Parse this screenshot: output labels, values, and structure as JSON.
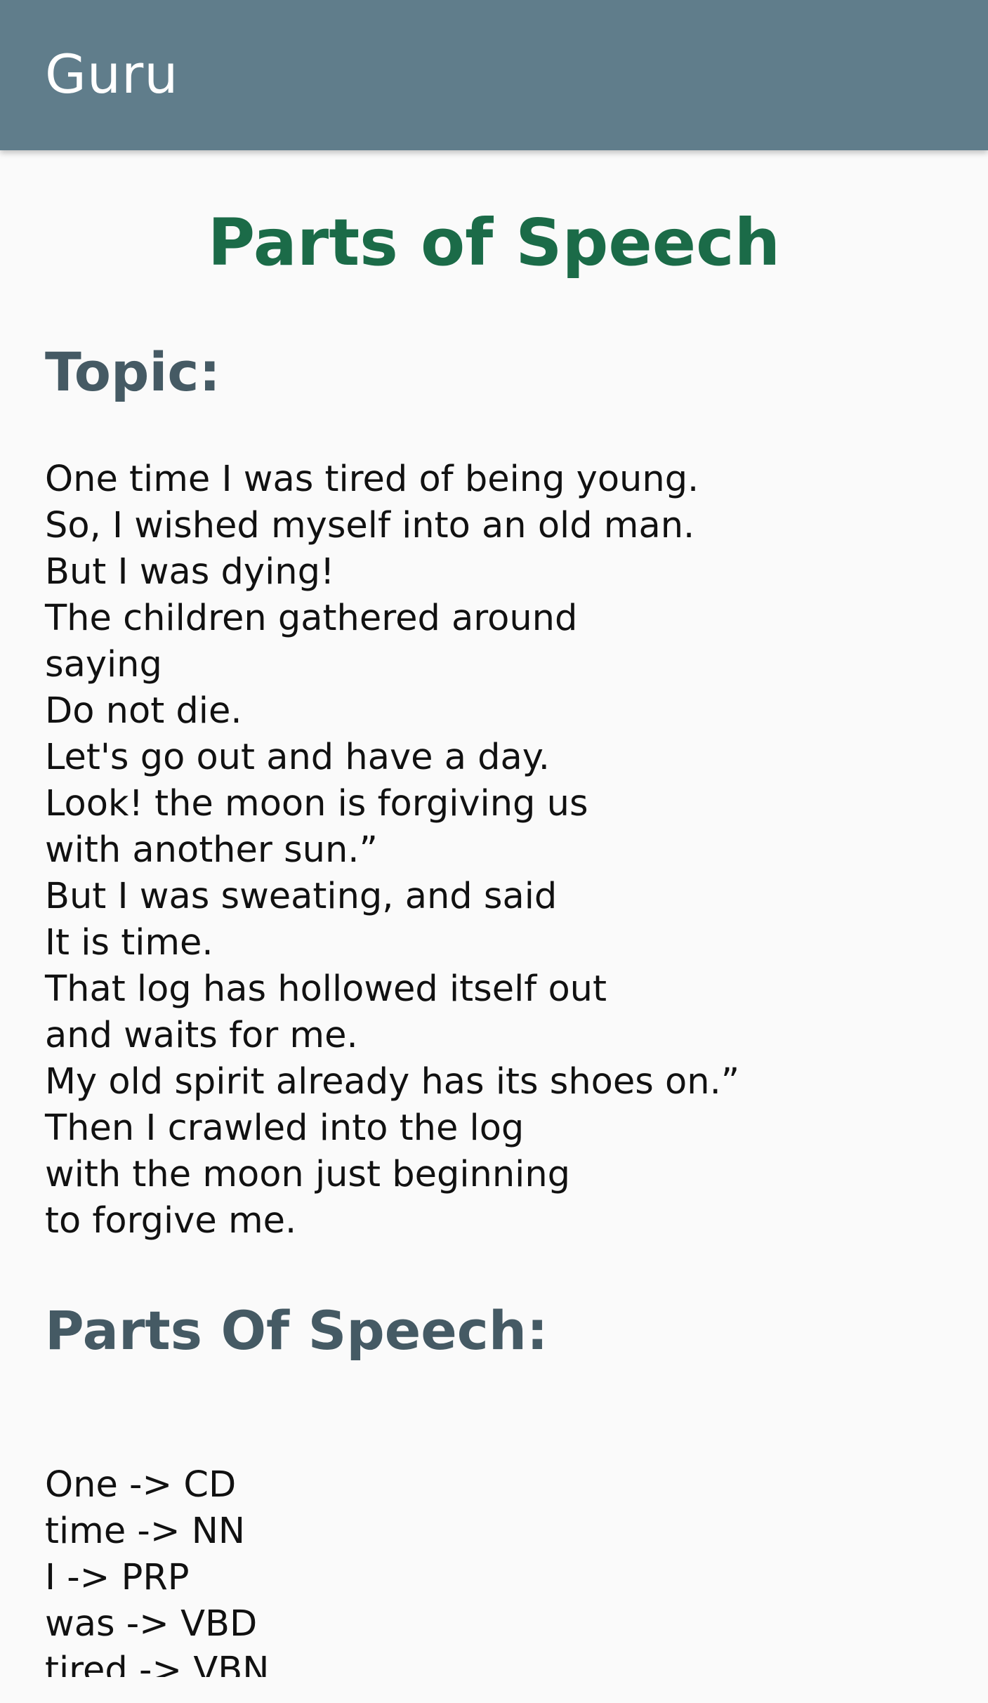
{
  "app_bar": {
    "title": "Guru"
  },
  "page": {
    "title": "Parts of Speech",
    "topic_heading": "Topic:",
    "poem_lines": [
      "One time I was tired of being young.",
      "So, I wished myself into an old man.",
      "But I was dying!",
      "The children gathered around",
      "saying",
      "Do not die.",
      "Let's go out and have a day.",
      "Look! the moon is forgiving us",
      "with another sun.”",
      "But I was sweating, and said",
      "It is time.",
      "That log has hollowed itself out",
      "and waits for me.",
      "My old spirit already has its shoes on.”",
      "Then I crawled into the log",
      "with the moon just beginning",
      "to forgive me."
    ],
    "pos_heading": "Parts Of Speech:",
    "pos_tags": [
      "One -> CD",
      "time -> NN",
      "I -> PRP",
      "was -> VBD",
      "tired -> VBN"
    ]
  },
  "colors": {
    "app_bar": "#607d8b",
    "title": "#1b6b48",
    "heading": "#455a64",
    "background": "#fafafa"
  }
}
